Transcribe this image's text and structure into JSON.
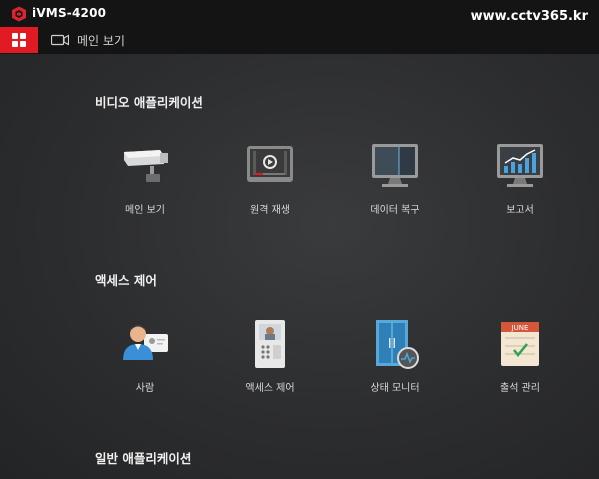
{
  "app": {
    "title": "iVMS-4200",
    "watermark": "www.cctv365.kr"
  },
  "tabs": {
    "main_view": "메인 보기"
  },
  "sections": {
    "video": {
      "title": "비디오 애플리케이션",
      "items": [
        "메인 보기",
        "원격 재생",
        "데이터 복구",
        "보고서"
      ]
    },
    "access": {
      "title": "액세스 제어",
      "items": [
        "사람",
        "액세스 제어",
        "상태 모니터",
        "출석 관리"
      ]
    },
    "general": {
      "title": "일반 애플리케이션"
    }
  },
  "calendar_month": "JUNE",
  "colors": {
    "accent": "#e21b23",
    "topbar": "#141414",
    "background": "#2b2c2e"
  }
}
